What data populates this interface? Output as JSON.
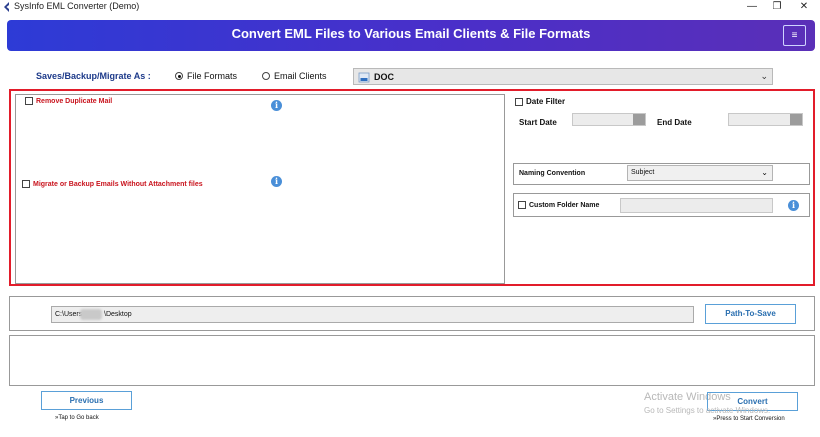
{
  "window": {
    "title": "SysInfo EML Converter (Demo)",
    "minimize_glyph": "—",
    "maximize_glyph": "❐",
    "close_glyph": "✕"
  },
  "header": {
    "heading": "Convert EML Files to Various Email Clients & File Formats",
    "menu_glyph": "≡"
  },
  "save_as": {
    "label": "Saves/Backup/Migrate As :",
    "options": [
      {
        "label": "File Formats",
        "selected": true
      },
      {
        "label": "Email Clients",
        "selected": false
      }
    ],
    "format_value": "DOC",
    "format_icon": "doc-file-icon"
  },
  "left_options": {
    "remove_duplicate": "Remove Duplicate Mail",
    "without_attachment": "Migrate or Backup Emails Without Attachment files",
    "info_glyph": "i"
  },
  "date_filter": {
    "label": "Date Filter",
    "start_label": "Start Date",
    "end_label": "End Date"
  },
  "naming": {
    "label": "Naming Convention",
    "value": "Subject"
  },
  "custom_folder": {
    "label": "Custom Folder Name"
  },
  "path": {
    "value_prefix": "C:\\Users",
    "value_suffix": "\\Desktop",
    "button_label": "Path-To-Save"
  },
  "footer": {
    "previous_label": "Previous",
    "previous_hint": "»Tap to Go back",
    "convert_label": "Convert",
    "convert_hint": "»Press to Start Conversion"
  },
  "watermark": {
    "line1": "Activate Windows",
    "line2": "Go to Settings to activate Windows."
  },
  "colors": {
    "header_start": "#2d3bd6",
    "header_end": "#5a2fb8",
    "highlight_border": "#e21c2a",
    "option_red": "#c9141e",
    "button_blue": "#2a6fb0"
  }
}
